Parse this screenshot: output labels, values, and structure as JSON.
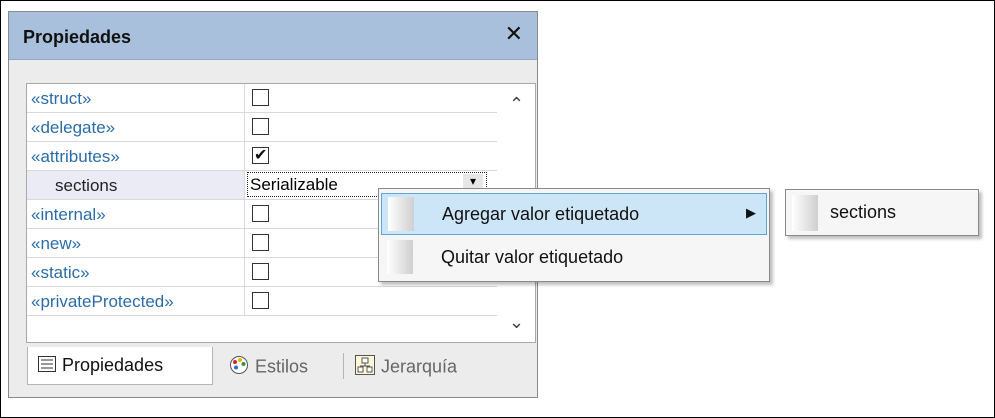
{
  "panel": {
    "title": "Propiedades",
    "close_icon": "close-icon"
  },
  "rows": [
    {
      "name": "«struct»",
      "type": "checkbox",
      "checked": false
    },
    {
      "name": "«delegate»",
      "type": "checkbox",
      "checked": false
    },
    {
      "name": "«attributes»",
      "type": "checkbox",
      "checked": true
    },
    {
      "name": "sections",
      "type": "value",
      "value": "Serializable"
    },
    {
      "name": "«internal»",
      "type": "checkbox",
      "checked": false
    },
    {
      "name": "«new»",
      "type": "checkbox",
      "checked": false
    },
    {
      "name": "«static»",
      "type": "checkbox",
      "checked": false
    },
    {
      "name": "«privateProtected»",
      "type": "checkbox",
      "checked": false
    }
  ],
  "tabs": [
    {
      "label": "Propiedades",
      "icon": "properties-icon",
      "active": true
    },
    {
      "label": "Estilos",
      "icon": "palette-icon",
      "active": false
    },
    {
      "label": "Jerarquía",
      "icon": "hierarchy-icon",
      "active": false
    }
  ],
  "context_menu": {
    "items": [
      {
        "label": "Agregar valor etiquetado",
        "highlighted": true,
        "has_submenu": true
      },
      {
        "label": "Quitar valor etiquetado",
        "highlighted": false,
        "has_submenu": false
      }
    ],
    "submenu": {
      "items": [
        "sections"
      ]
    }
  },
  "colors": {
    "header": "#a8c0dc",
    "stereotype_text": "#2b6ca8",
    "menu_highlight": "#cde6f7"
  }
}
